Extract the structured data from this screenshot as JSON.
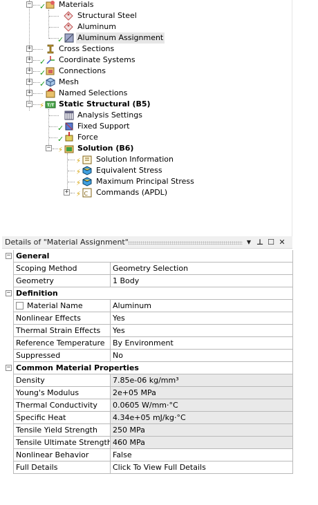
{
  "tree": {
    "items": [
      {
        "label": "Materials",
        "bold": false
      },
      {
        "label": "Structural Steel",
        "bold": false
      },
      {
        "label": "Aluminum",
        "bold": false
      },
      {
        "label": "Aluminum Assignment",
        "bold": false
      },
      {
        "label": "Cross Sections",
        "bold": false
      },
      {
        "label": "Coordinate Systems",
        "bold": false
      },
      {
        "label": "Connections",
        "bold": false
      },
      {
        "label": "Mesh",
        "bold": false
      },
      {
        "label": "Named Selections",
        "bold": false
      },
      {
        "label": "Static Structural (B5)",
        "bold": true
      },
      {
        "label": "Analysis Settings",
        "bold": false
      },
      {
        "label": "Fixed Support",
        "bold": false
      },
      {
        "label": "Force",
        "bold": false
      },
      {
        "label": "Solution (B6)",
        "bold": true
      },
      {
        "label": "Solution Information",
        "bold": false
      },
      {
        "label": "Equivalent Stress",
        "bold": false
      },
      {
        "label": "Maximum Principal Stress",
        "bold": false
      },
      {
        "label": "Commands (APDL)",
        "bold": false
      }
    ]
  },
  "details": {
    "title": "Details of \"Material Assignment\"",
    "buttons": {
      "dropdown": "▼",
      "pin": "⊥",
      "maximize": "☐",
      "close": "✕"
    },
    "sections": {
      "general": "General",
      "definition": "Definition",
      "common": "Common Material Properties"
    },
    "rows": {
      "scoping_method": {
        "label": "Scoping Method",
        "value": "Geometry Selection"
      },
      "geometry": {
        "label": "Geometry",
        "value": "1 Body"
      },
      "material_name": {
        "label": "Material Name",
        "value": "Aluminum"
      },
      "nonlinear_effects": {
        "label": "Nonlinear Effects",
        "value": "Yes"
      },
      "thermal_strain": {
        "label": "Thermal Strain Effects",
        "value": "Yes"
      },
      "reference_temp": {
        "label": "Reference Temperature",
        "value": "By Environment"
      },
      "suppressed": {
        "label": "Suppressed",
        "value": "No"
      },
      "density": {
        "label": "Density",
        "value": "7.85e-06 kg/mm³"
      },
      "youngs": {
        "label": "Young's Modulus",
        "value": "2e+05 MPa"
      },
      "thermal_cond": {
        "label": "Thermal Conductivity",
        "value": "0.0605 W/mm·°C"
      },
      "specific_heat": {
        "label": "Specific Heat",
        "value": "4.34e+05 mJ/kg·°C"
      },
      "tensile_yield": {
        "label": "Tensile Yield Strength",
        "value": "250 MPa"
      },
      "tensile_ult": {
        "label": "Tensile Ultimate Strength",
        "value": "460 MPa"
      },
      "nonlinear_behavior": {
        "label": "Nonlinear Behavior",
        "value": "False"
      },
      "full_details": {
        "label": "Full Details",
        "value": "Click To View Full Details"
      }
    }
  },
  "colors": {
    "check": "#1b9a1b",
    "gray_cell": "#e9e9e9",
    "accent_strip": "#f7d35a"
  }
}
